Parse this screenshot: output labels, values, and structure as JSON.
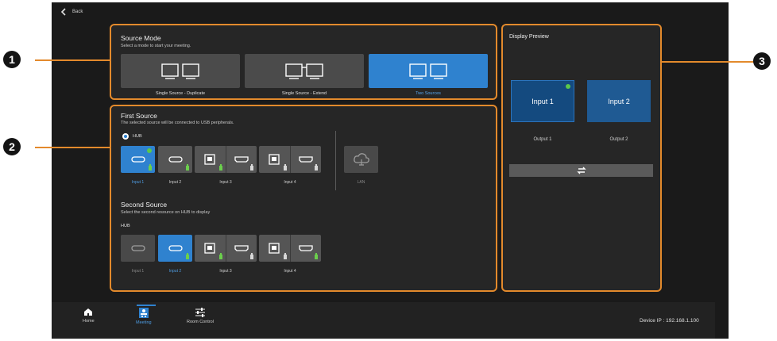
{
  "back": {
    "label": "Back"
  },
  "source_mode": {
    "title": "Source Mode",
    "subtitle": "Select a mode to start your meeting.",
    "modes": [
      {
        "label": "Single Source - Duplicate",
        "selected": false
      },
      {
        "label": "Single Source - Extend",
        "selected": false
      },
      {
        "label": "Two Sources",
        "selected": true
      }
    ]
  },
  "first_source": {
    "title": "First Source",
    "subtitle": "The selected source will be connected to USB peripherals.",
    "hub_label": "HUB",
    "inputs": [
      "Input 1",
      "Input 2",
      "Input 3",
      "Input 4"
    ],
    "lan_label": "LAN"
  },
  "second_source": {
    "title": "Second Source",
    "subtitle": "Select the second resource on HUB to display",
    "hub_label": "HUB",
    "inputs": [
      "Input 1",
      "Input 2",
      "Input 3",
      "Input 4"
    ]
  },
  "preview": {
    "title": "Display Preview",
    "outputs": [
      {
        "box_label": "Input 1",
        "label": "Output 1"
      },
      {
        "box_label": "Input 2",
        "label": "Output 2"
      }
    ]
  },
  "nav": {
    "items": [
      "Home",
      "Meeting",
      "Room Control"
    ]
  },
  "device_ip": "Device IP : 192.168.1.100",
  "callouts": [
    "1",
    "2",
    "3"
  ],
  "colors": {
    "accent": "#2f82cf",
    "highlight": "#e38a2c",
    "status": "#5bc84a"
  }
}
